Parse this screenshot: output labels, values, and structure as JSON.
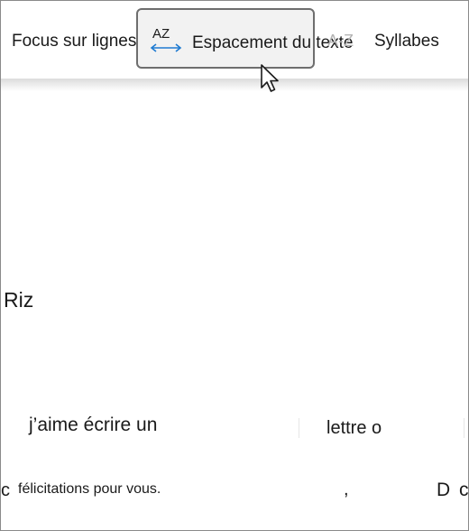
{
  "toolbar": {
    "focus_label": "Focus sur lignes",
    "spacing_label": "Espacement du texte",
    "spacing_icon_text": "AZ",
    "faded_icon_text": "A-Z",
    "syllabes_label": "Syllabes"
  },
  "content": {
    "riz": "Riz",
    "jaime": "j’aime écrire un",
    "lettre": "lettre o",
    "c_left": "c",
    "felicitations": "félicitations pour vous.",
    "comma": ",",
    "d": "D",
    "c_right": "c"
  },
  "colors": {
    "accent_arrow": "#1f7bd1",
    "button_border": "#6e6e6e",
    "button_bg": "#f2f2f2"
  }
}
